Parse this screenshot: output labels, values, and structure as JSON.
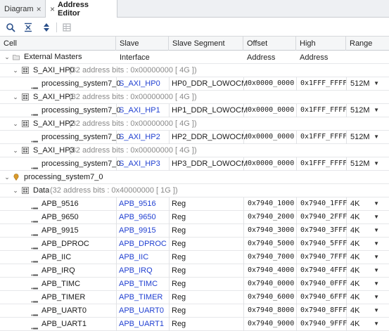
{
  "tabs": {
    "diagram": "Diagram",
    "address_editor": "Address Editor"
  },
  "columns": {
    "cell": "Cell",
    "slave_interface": "Slave Interface",
    "slave_segment": "Slave Segment",
    "offset_address": "Offset Address",
    "high_address": "High Address",
    "range": "Range"
  },
  "tree": {
    "external_masters": "External Masters",
    "hp0": {
      "name": "S_AXI_HP0",
      "info": "(32 address bits : 0x00000000 [ 4G ])"
    },
    "hp0_row": {
      "cell": "processing_system7_0",
      "iface": "S_AXI_HP0",
      "segment": "HP0_DDR_LOWOCM",
      "offset": "0x0000_0000",
      "high": "0x1FFF_FFFF",
      "range": "512M"
    },
    "hp1": {
      "name": "S_AXI_HP1",
      "info": "(32 address bits : 0x00000000 [ 4G ])"
    },
    "hp1_row": {
      "cell": "processing_system7_0",
      "iface": "S_AXI_HP1",
      "segment": "HP1_DDR_LOWOCM",
      "offset": "0x0000_0000",
      "high": "0x1FFF_FFFF",
      "range": "512M"
    },
    "hp2": {
      "name": "S_AXI_HP2",
      "info": "(32 address bits : 0x00000000 [ 4G ])"
    },
    "hp2_row": {
      "cell": "processing_system7_0",
      "iface": "S_AXI_HP2",
      "segment": "HP2_DDR_LOWOCM",
      "offset": "0x0000_0000",
      "high": "0x1FFF_FFFF",
      "range": "512M"
    },
    "hp3": {
      "name": "S_AXI_HP3",
      "info": "(32 address bits : 0x00000000 [ 4G ])"
    },
    "hp3_row": {
      "cell": "processing_system7_0",
      "iface": "S_AXI_HP3",
      "segment": "HP3_DDR_LOWOCM",
      "offset": "0x0000_0000",
      "high": "0x1FFF_FFFF",
      "range": "512M"
    },
    "ps7": "processing_system7_0",
    "data": {
      "name": "Data",
      "info": "(32 address bits : 0x40000000 [ 1G ])"
    },
    "apb": [
      {
        "cell": "APB_9516",
        "iface": "APB_9516",
        "segment": "Reg",
        "offset": "0x7940_1000",
        "high": "0x7940_1FFF",
        "range": "4K"
      },
      {
        "cell": "APB_9650",
        "iface": "APB_9650",
        "segment": "Reg",
        "offset": "0x7940_2000",
        "high": "0x7940_2FFF",
        "range": "4K"
      },
      {
        "cell": "APB_9915",
        "iface": "APB_9915",
        "segment": "Reg",
        "offset": "0x7940_3000",
        "high": "0x7940_3FFF",
        "range": "4K"
      },
      {
        "cell": "APB_DPROC",
        "iface": "APB_DPROC",
        "segment": "Reg",
        "offset": "0x7940_5000",
        "high": "0x7940_5FFF",
        "range": "4K"
      },
      {
        "cell": "APB_IIC",
        "iface": "APB_IIC",
        "segment": "Reg",
        "offset": "0x7940_7000",
        "high": "0x7940_7FFF",
        "range": "4K"
      },
      {
        "cell": "APB_IRQ",
        "iface": "APB_IRQ",
        "segment": "Reg",
        "offset": "0x7940_4000",
        "high": "0x7940_4FFF",
        "range": "4K"
      },
      {
        "cell": "APB_TIMC",
        "iface": "APB_TIMC",
        "segment": "Reg",
        "offset": "0x7940_0000",
        "high": "0x7940_0FFF",
        "range": "4K"
      },
      {
        "cell": "APB_TIMER",
        "iface": "APB_TIMER",
        "segment": "Reg",
        "offset": "0x7940_6000",
        "high": "0x7940_6FFF",
        "range": "4K"
      },
      {
        "cell": "APB_UART0",
        "iface": "APB_UART0",
        "segment": "Reg",
        "offset": "0x7940_8000",
        "high": "0x7940_8FFF",
        "range": "4K"
      },
      {
        "cell": "APB_UART1",
        "iface": "APB_UART1",
        "segment": "Reg",
        "offset": "0x7940_9000",
        "high": "0x7940_9FFF",
        "range": "4K"
      }
    ]
  },
  "icons": {
    "search": "search-icon",
    "collapse_all": "collapse-all-icon",
    "expand_all": "expand-all-icon",
    "auto_assign": "auto-assign-icon"
  },
  "colors": {
    "link": "#1f3fd1",
    "info": "#8a8a8a",
    "tab_bg": "#eef0f3"
  }
}
